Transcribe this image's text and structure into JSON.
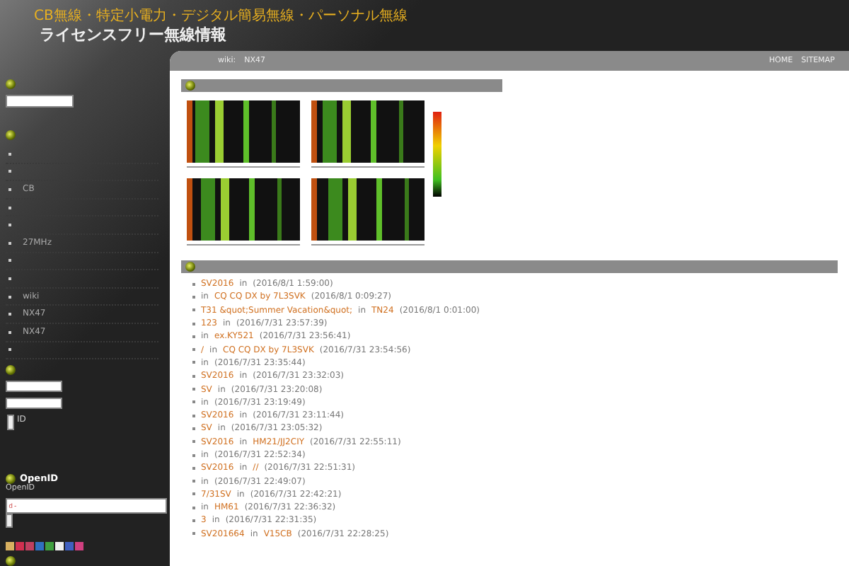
{
  "header": {
    "tagline": "CB無線・特定小電力・デジタル簡易無線・パーソナル無線",
    "title": "ライセンスフリー無線情報"
  },
  "breadcrumb": [
    "wiki:",
    "NX47"
  ],
  "top_nav": [
    "HOME",
    "SITEMAP"
  ],
  "sidebar": {
    "menu": [
      {
        "kind": "blank"
      },
      {
        "kind": "blank"
      },
      {
        "kind": "link",
        "label": "CB"
      },
      {
        "kind": "blank"
      },
      {
        "kind": "blank"
      },
      {
        "kind": "link",
        "label": "27MHz"
      },
      {
        "kind": "blank"
      },
      {
        "kind": "blank"
      },
      {
        "kind": "link",
        "label": "wiki"
      },
      {
        "kind": "link",
        "label": "NX47"
      },
      {
        "kind": "link",
        "label": "NX47"
      },
      {
        "kind": "blank"
      }
    ],
    "login": {
      "remember_label": "ID",
      "remember": {
        "checked": false
      }
    },
    "openid": {
      "heading": "OpenID",
      "label": "OpenID",
      "value": "ｄ-"
    }
  },
  "recent": [
    {
      "title": "SV2016",
      "in": "in",
      "date": "(2016/8/1 1:59:00)"
    },
    {
      "in": "in",
      "category": "CQ CQ DX by 7L3SVK",
      "date": "(2016/8/1 0:09:27)"
    },
    {
      "title": "T31 &quot;Summer Vacation&quot;",
      "in": "in",
      "category": "TN24",
      "date": "(2016/8/1 0:01:00)"
    },
    {
      "title": "123",
      "in": "in",
      "date": "(2016/7/31 23:57:39)"
    },
    {
      "in": "in",
      "category": "ex.KY521",
      "date": "(2016/7/31 23:56:41)"
    },
    {
      "title": "/",
      "in": "in",
      "category": "CQ CQ DX by 7L3SVK",
      "date": "(2016/7/31 23:54:56)"
    },
    {
      "in": "in",
      "date": "(2016/7/31 23:35:44)"
    },
    {
      "title": "SV2016",
      "in": "in",
      "date": "(2016/7/31 23:32:03)"
    },
    {
      "title": "SV",
      "in": "in",
      "date": "(2016/7/31 23:20:08)"
    },
    {
      "in": "in",
      "date": "(2016/7/31 23:19:49)"
    },
    {
      "title": "SV2016",
      "in": "in",
      "date": "(2016/7/31 23:11:44)"
    },
    {
      "title": "SV",
      "in": "in",
      "date": "(2016/7/31 23:05:32)"
    },
    {
      "title": "SV2016",
      "in": "in",
      "category": "HM21/JJ2CIY",
      "date": "(2016/7/31 22:55:11)"
    },
    {
      "in": "in",
      "date": "(2016/7/31 22:52:34)"
    },
    {
      "title": "SV2016",
      "in": "in",
      "category": "//",
      "date": "(2016/7/31 22:51:31)"
    },
    {
      "in": "in",
      "date": "(2016/7/31 22:49:07)"
    },
    {
      "title": "7/31SV",
      "in": "in",
      "date": "(2016/7/31 22:42:21)"
    },
    {
      "in": "in",
      "category": "HM61",
      "date": "(2016/7/31 22:36:32)"
    },
    {
      "title": "3",
      "in": "in",
      "date": "(2016/7/31 22:31:35)"
    },
    {
      "title": "SV201664",
      "in": "in",
      "category": "V15CB",
      "date": "(2016/7/31 22:28:25)"
    }
  ]
}
